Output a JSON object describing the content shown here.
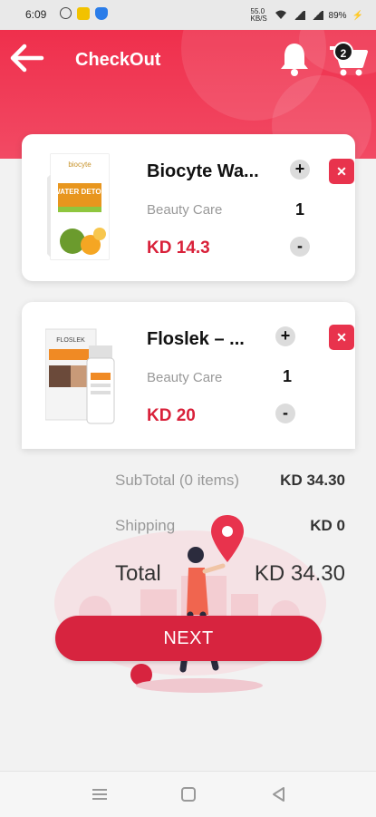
{
  "status_bar": {
    "time": "6:09",
    "network_speed": "55.0 KB/S",
    "battery": "89%"
  },
  "header": {
    "title": "CheckOut",
    "cart_count": "2"
  },
  "items": [
    {
      "name": "Biocyte Wa...",
      "category": "Beauty Care",
      "price": "KD 14.3",
      "quantity": "1",
      "image_brand": "biocyte",
      "image_text": "WATER DETOX"
    },
    {
      "name": "Floslek – ...",
      "category": "Beauty Care",
      "price": "KD 20",
      "quantity": "1",
      "image_brand": "FLOSLEK"
    }
  ],
  "summary": {
    "subtotal_label": "SubTotal (0 items)",
    "subtotal_value": "KD 34.30",
    "shipping_label": "Shipping",
    "shipping_value": "KD 0",
    "total_label": "Total",
    "total_value": "KD 34.30"
  },
  "next_label": "NEXT",
  "icons": {
    "back": "arrow-left-icon",
    "bell": "bell-icon",
    "cart": "cart-icon",
    "add": "plus-icon",
    "remove": "close-icon",
    "subtract": "minus-icon"
  },
  "colors": {
    "brand_red": "#ef2f4c",
    "price_red": "#d9213a",
    "button_red": "#d7243f"
  }
}
